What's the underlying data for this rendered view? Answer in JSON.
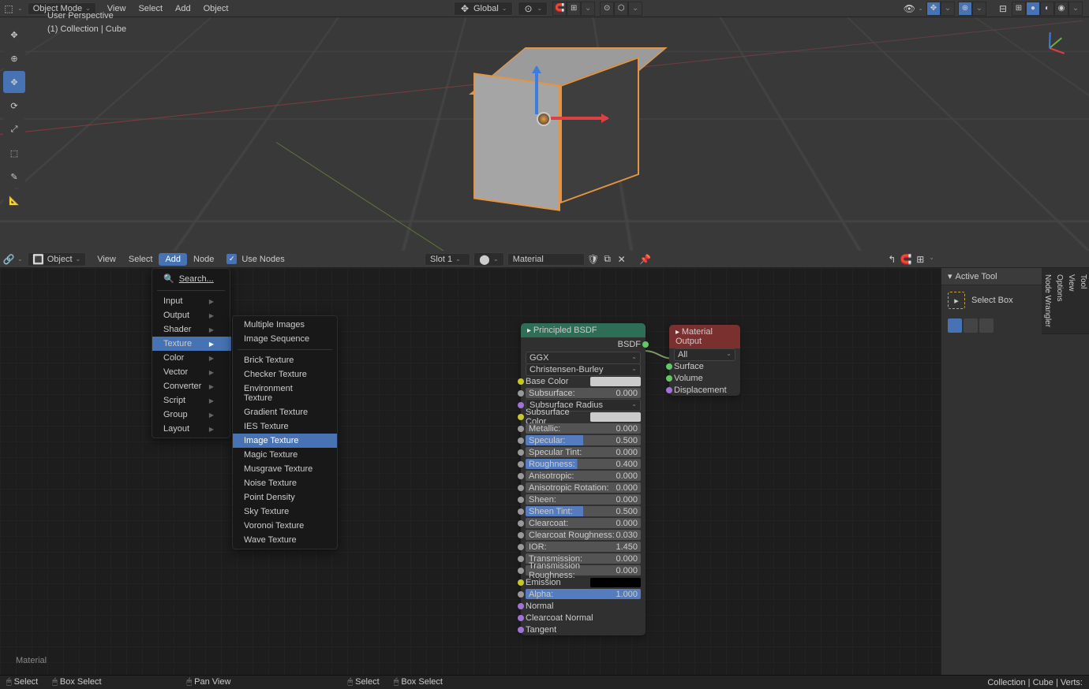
{
  "viewport": {
    "header": {
      "mode": "Object Mode",
      "menus": [
        "View",
        "Select",
        "Add",
        "Object"
      ],
      "orientation": "Global"
    },
    "info_line1": "User Perspective",
    "info_line2": "(1) Collection | Cube",
    "tools": [
      "cursor",
      "select",
      "move",
      "rotate",
      "scale",
      "transform",
      "annotate",
      "measure"
    ]
  },
  "node_editor": {
    "header": {
      "mode": "Object",
      "menus": [
        "View",
        "Select",
        "Add",
        "Node"
      ],
      "use_nodes_label": "Use Nodes",
      "slot": "Slot 1",
      "material_name": "Material"
    },
    "material_label": "Material",
    "add_menu": {
      "search": "Search...",
      "categories": [
        "Input",
        "Output",
        "Shader",
        "Texture",
        "Color",
        "Vector",
        "Converter",
        "Script",
        "Group",
        "Layout"
      ],
      "highlighted": "Texture"
    },
    "texture_menu": {
      "group1": [
        "Multiple Images",
        "Image Sequence"
      ],
      "group2": [
        "Brick Texture",
        "Checker Texture",
        "Environment Texture",
        "Gradient Texture",
        "IES Texture",
        "Image Texture",
        "Magic Texture",
        "Musgrave Texture",
        "Noise Texture",
        "Point Density",
        "Sky Texture",
        "Voronoi Texture",
        "Wave Texture"
      ],
      "highlighted": "Image Texture"
    },
    "principled": {
      "title": "Principled BSDF",
      "output": "BSDF",
      "dd1": "GGX",
      "dd2": "Christensen-Burley",
      "props": [
        {
          "label": "Base Color",
          "type": "color",
          "color": "#cccccc",
          "sock": "y"
        },
        {
          "label": "Subsurface:",
          "value": "0.000",
          "type": "slider",
          "sock": "gr"
        },
        {
          "label": "Subsurface Radius",
          "type": "dd",
          "sock": "p"
        },
        {
          "label": "Subsurface Color",
          "type": "color",
          "color": "#cccccc",
          "sock": "y"
        },
        {
          "label": "Metallic:",
          "value": "0.000",
          "type": "slider",
          "sock": "gr"
        },
        {
          "label": "Specular:",
          "value": "0.500",
          "type": "slider-b",
          "sock": "gr"
        },
        {
          "label": "Specular Tint:",
          "value": "0.000",
          "type": "slider",
          "sock": "gr"
        },
        {
          "label": "Roughness:",
          "value": "0.400",
          "type": "slider-bs",
          "sock": "gr"
        },
        {
          "label": "Anisotropic:",
          "value": "0.000",
          "type": "slider",
          "sock": "gr"
        },
        {
          "label": "Anisotropic Rotation:",
          "value": "0.000",
          "type": "slider",
          "sock": "gr"
        },
        {
          "label": "Sheen:",
          "value": "0.000",
          "type": "slider",
          "sock": "gr"
        },
        {
          "label": "Sheen Tint:",
          "value": "0.500",
          "type": "slider-b",
          "sock": "gr"
        },
        {
          "label": "Clearcoat:",
          "value": "0.000",
          "type": "slider",
          "sock": "gr"
        },
        {
          "label": "Clearcoat Roughness:",
          "value": "0.030",
          "type": "slider",
          "sock": "gr"
        },
        {
          "label": "IOR:",
          "value": "1.450",
          "type": "text",
          "sock": "gr"
        },
        {
          "label": "Transmission:",
          "value": "0.000",
          "type": "slider",
          "sock": "gr"
        },
        {
          "label": "Transmission Roughness:",
          "value": "0.000",
          "type": "slider",
          "sock": "gr"
        },
        {
          "label": "Emission",
          "type": "color",
          "color": "#000000",
          "sock": "y"
        },
        {
          "label": "Alpha:",
          "value": "1.000",
          "type": "slider-f",
          "sock": "gr"
        },
        {
          "label": "Normal",
          "type": "plain",
          "sock": "p"
        },
        {
          "label": "Clearcoat Normal",
          "type": "plain",
          "sock": "p"
        },
        {
          "label": "Tangent",
          "type": "plain",
          "sock": "p"
        }
      ]
    },
    "mat_output": {
      "title": "Material Output",
      "target": "All",
      "inputs": [
        "Surface",
        "Volume",
        "Displacement"
      ]
    }
  },
  "side_panel": {
    "title": "Active Tool",
    "tool": "Select Box",
    "tabs": [
      "Tool",
      "View",
      "Options",
      "Node Wrangler"
    ]
  },
  "status": {
    "left": [
      {
        "icon": "🖱",
        "label": "Select"
      },
      {
        "icon": "🖱",
        "label": "Box Select"
      },
      {
        "icon": "🖱",
        "label": "Pan View"
      },
      {
        "icon": "🖱",
        "label": "Select"
      },
      {
        "icon": "🖱",
        "label": "Box Select"
      }
    ],
    "right": "Collection | Cube | Verts:"
  }
}
